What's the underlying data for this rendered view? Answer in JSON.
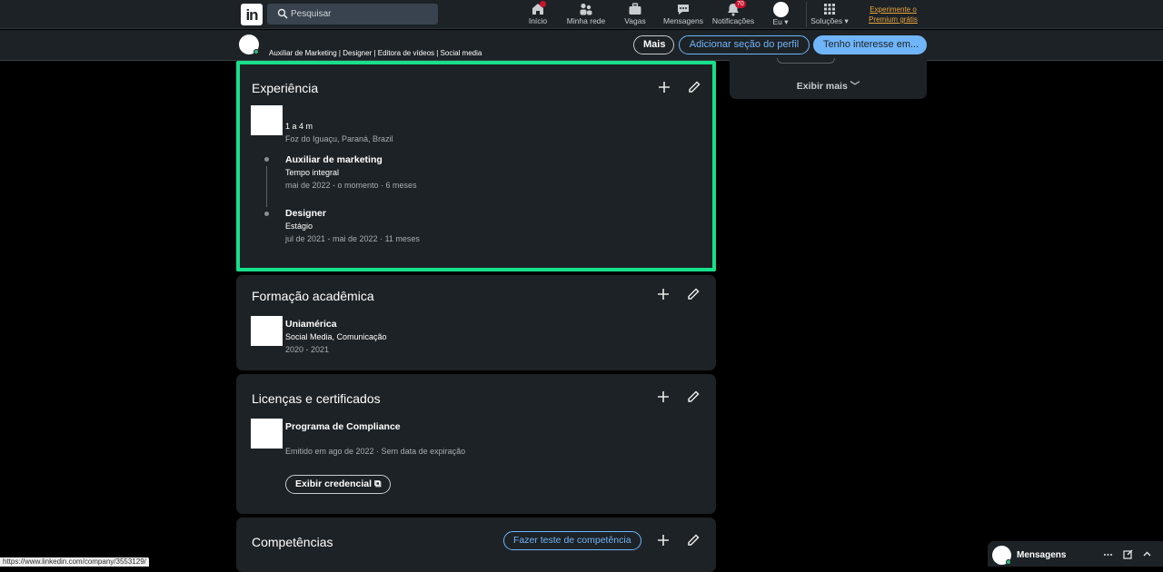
{
  "nav": {
    "search_placeholder": "Pesquisar",
    "items": [
      {
        "label": "Início",
        "icon": "home-icon"
      },
      {
        "label": "Minha rede",
        "icon": "network-icon"
      },
      {
        "label": "Vagas",
        "icon": "briefcase-icon"
      },
      {
        "label": "Mensagens",
        "icon": "messaging-icon"
      },
      {
        "label": "Notificações",
        "icon": "bell-icon",
        "badge": "70"
      },
      {
        "label": "Eu",
        "icon": "avatar"
      },
      {
        "label": "Soluções",
        "icon": "grid-icon"
      }
    ],
    "premium": "Experimente o Premium grátis"
  },
  "subbar": {
    "headline": "Auxiliar de Marketing | Designer | Editora de vídeos | Social media",
    "more": "Mais",
    "add_section": "Adicionar seção do perfil",
    "interest": "Tenho interesse em..."
  },
  "experience": {
    "title": "Experiência",
    "total": "1 a 4 m",
    "location": "Foz do Iguaçu, Paraná, Brazil",
    "roles": [
      {
        "title": "Auxiliar de marketing",
        "type": "Tempo integral",
        "period": "mai de 2022 - o momento · 6 meses"
      },
      {
        "title": "Designer",
        "type": "Estágio",
        "period": "jul de 2021 - mai de 2022 · 11 meses"
      }
    ]
  },
  "education": {
    "title": "Formação acadêmica",
    "school": "Uniamérica",
    "field": "Social Media, Comunicação",
    "years": "2020 - 2021"
  },
  "licenses": {
    "title": "Licenças e certificados",
    "name": "Programa de Compliance",
    "issued": "Emitido em ago de 2022 · Sem data de expiração",
    "credential": "Exibir credencial"
  },
  "skills": {
    "title": "Competências",
    "test": "Fazer teste de competência"
  },
  "sidebar": {
    "show_more": "Exibir mais"
  },
  "status_url": "https://www.linkedin.com/company/3553129/",
  "messaging": {
    "title": "Mensagens"
  },
  "colors": {
    "accent": "#70b5f9",
    "highlight": "#16e08b",
    "badge": "#cb112d",
    "premium": "#e7a33e"
  }
}
